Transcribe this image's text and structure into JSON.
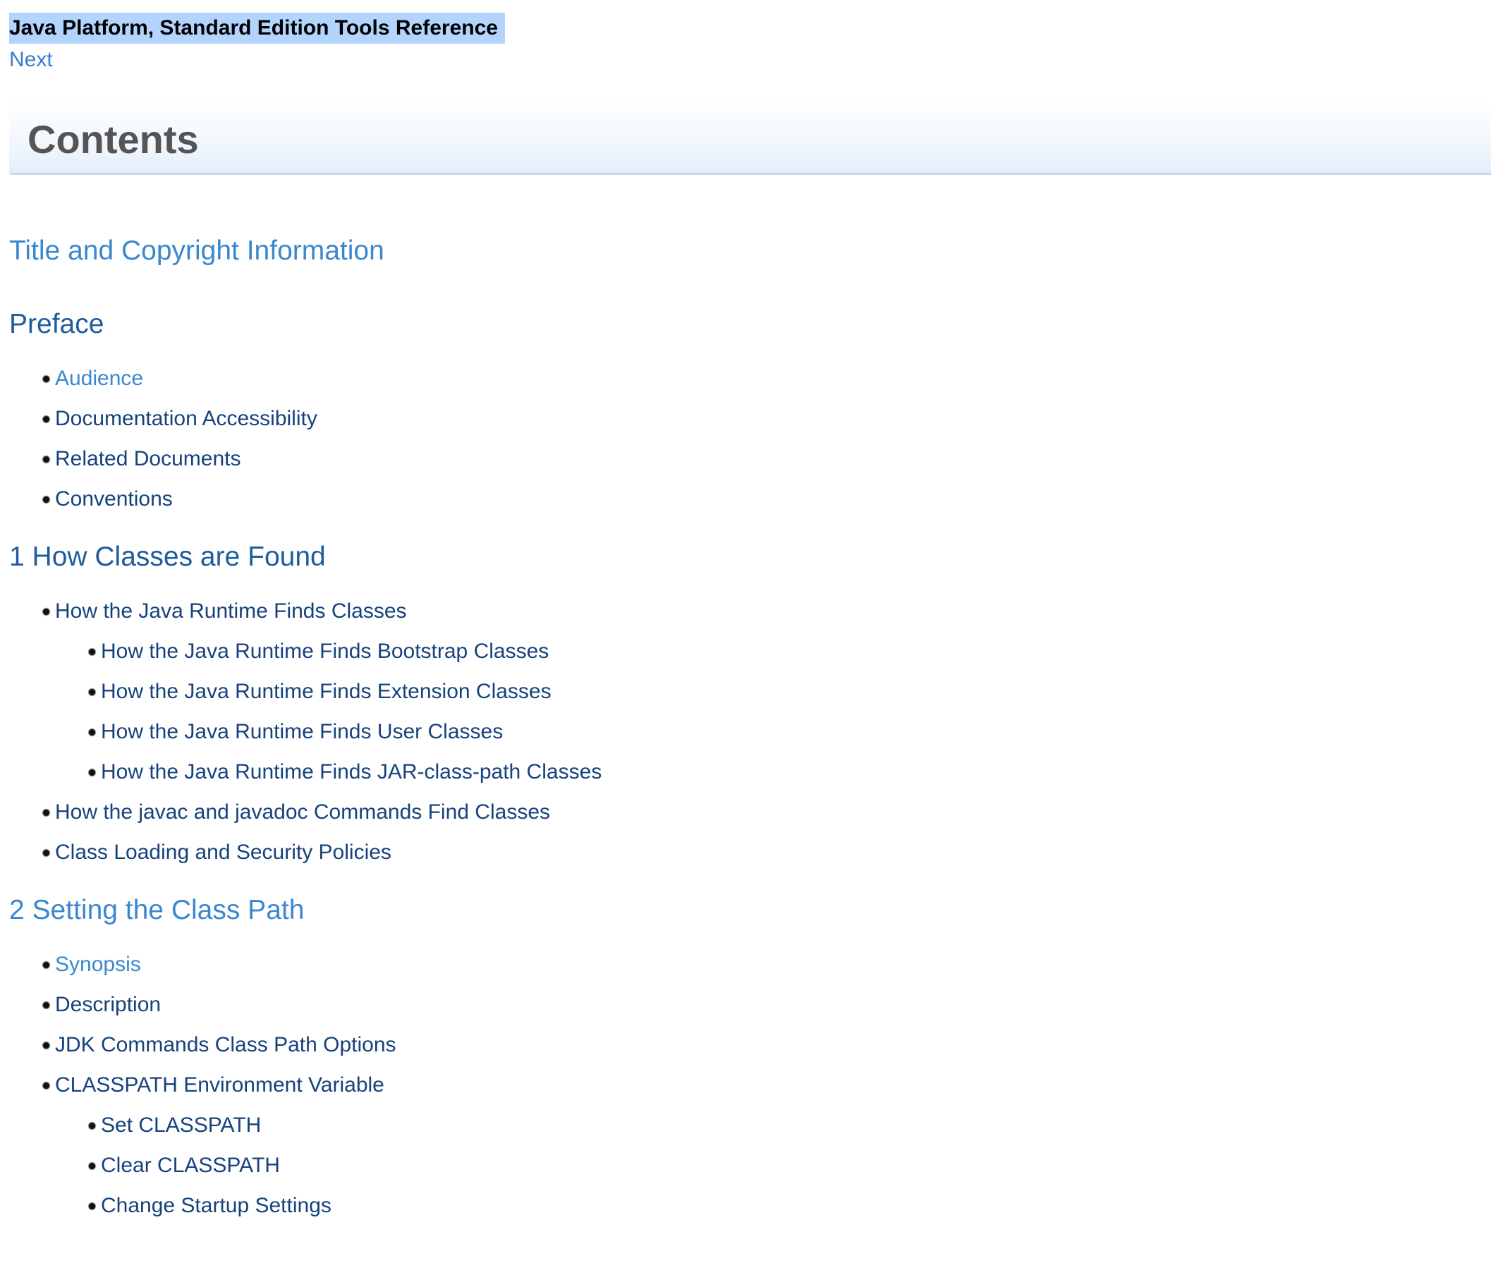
{
  "header": {
    "book_title": "Java Platform, Standard Edition Tools Reference",
    "next_label": "Next"
  },
  "contents_title": "Contents",
  "colors": {
    "link_dark": "#16427c",
    "link_light": "#3a87d0",
    "selection_highlight": "#b3d4fc",
    "heading_gray": "#555555"
  },
  "toc": {
    "title_copyright": "Title and Copyright Information",
    "preface": {
      "title": "Preface",
      "items": [
        "Audience",
        "Documentation Accessibility",
        "Related Documents",
        "Conventions"
      ]
    },
    "ch1": {
      "title": "1 How Classes are Found",
      "item1": "How the Java Runtime Finds Classes",
      "item1_sub": [
        "How the Java Runtime Finds Bootstrap Classes",
        "How the Java Runtime Finds Extension Classes",
        "How the Java Runtime Finds User Classes",
        "How the Java Runtime Finds JAR-class-path Classes"
      ],
      "item2": "How the javac and javadoc Commands Find Classes",
      "item3": "Class Loading and Security Policies"
    },
    "ch2": {
      "title": "2 Setting the Class Path",
      "items": [
        "Synopsis",
        "Description",
        "JDK Commands Class Path Options",
        "CLASSPATH Environment Variable"
      ],
      "item4_sub": [
        "Set CLASSPATH",
        "Clear CLASSPATH",
        "Change Startup Settings"
      ]
    }
  }
}
